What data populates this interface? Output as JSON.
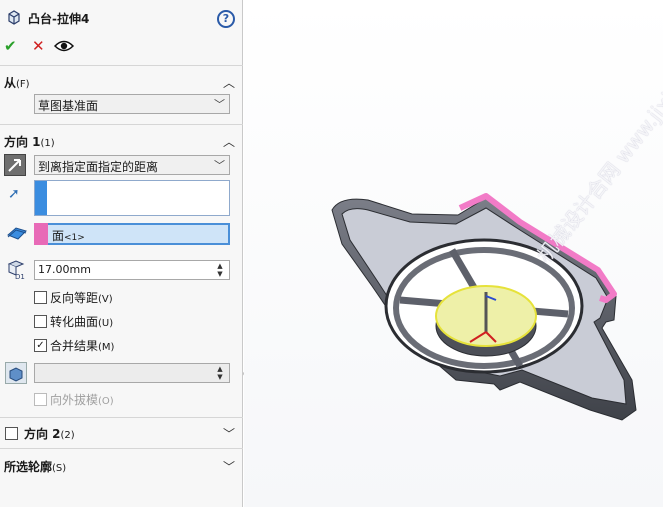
{
  "header": {
    "title": "凸台-拉伸4",
    "help_glyph": "?",
    "ok_glyph": "✔",
    "cancel_glyph": "✕"
  },
  "from": {
    "label": "从",
    "hotkey": "(F)",
    "value": "草图基准面"
  },
  "direction1": {
    "label": "方向 1",
    "hotkey": "(1)",
    "end_condition": "到离指定面指定的距离",
    "face_value": "面",
    "face_tag": "<1>",
    "depth": "17.00mm",
    "options": [
      {
        "label": "反向等距",
        "hotkey": "(V)",
        "checked": false,
        "enabled": true
      },
      {
        "label": "转化曲面",
        "hotkey": "(U)",
        "checked": false,
        "enabled": true
      },
      {
        "label": "合并结果",
        "hotkey": "(M)",
        "checked": true,
        "enabled": true
      }
    ],
    "draft_value": "",
    "draft_outward": {
      "label": "向外拔模",
      "hotkey": "(O)",
      "checked": false,
      "enabled": false
    }
  },
  "direction2": {
    "label": "方向 2",
    "hotkey": "(2)",
    "checked": false
  },
  "selected_contours": {
    "label": "所选轮廓",
    "hotkey": "(S)"
  },
  "watermark": "机械设计合网 www.jixie.com",
  "colors": {
    "panel_bg": "#f7f7f7",
    "accent_blue": "#3b8de0",
    "accent_pink": "#e86ab7",
    "ok_green": "#2aa02a",
    "cancel_red": "#d02020",
    "model_gray": "#5b5e66",
    "face_yellow": "#eef0a8"
  }
}
